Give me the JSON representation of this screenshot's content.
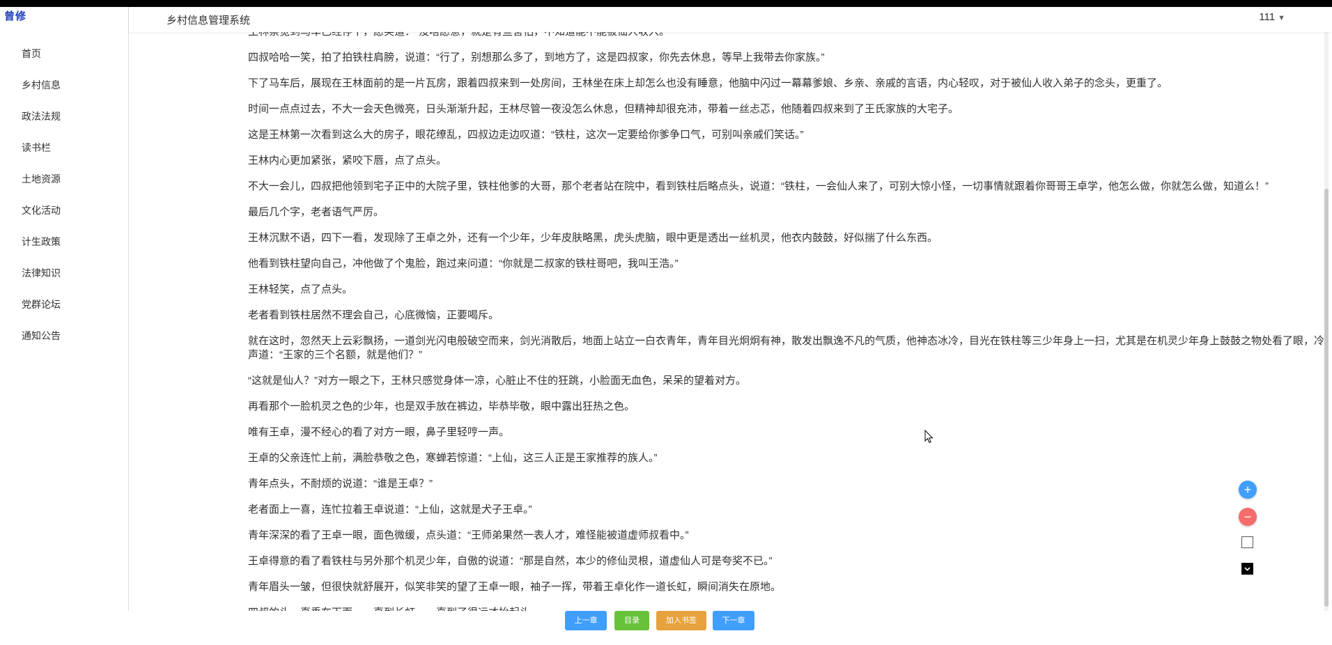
{
  "app": {
    "logo": "曾修",
    "system_title": "乡村信息管理系统",
    "user_name": "111"
  },
  "sidebar": {
    "items": [
      {
        "label": "首页"
      },
      {
        "label": "乡村信息"
      },
      {
        "label": "政法法规"
      },
      {
        "label": "读书栏"
      },
      {
        "label": "土地资源"
      },
      {
        "label": "文化活动"
      },
      {
        "label": "计生政策"
      },
      {
        "label": "法律知识"
      },
      {
        "label": "党群论坛"
      },
      {
        "label": "通知公告"
      }
    ]
  },
  "article": {
    "paragraphs": [
      "王林察觉到马车已经停下，愿笑道：“没啥愿意，就是有些害怕，不知道能不能被仙人收入。”",
      "四叔哈哈一笑，拍了拍铁柱肩膀，说道：“行了，别想那么多了，到地方了，这是四叔家，你先去休息，等早上我带去你家族。”",
      "下了马车后，展现在王林面前的是一片瓦房，跟着四叔来到一处房间，王林坐在床上却怎么也没有睡意，他脑中闪过一幕幕爹娘、乡亲、亲戚的言语，内心轻叹，对于被仙人收入弟子的念头，更重了。",
      "时间一点点过去，不大一会天色微亮，日头渐渐升起，王林尽管一夜没怎么休息，但精神却很充沛，带着一丝忐忑，他随着四叔来到了王氏家族的大宅子。",
      "这是王林第一次看到这么大的房子，眼花缭乱，四叔边走边叹道：“铁柱，这次一定要给你爹争口气，可别叫亲戚们笑话。”",
      "王林内心更加紧张，紧咬下唇，点了点头。",
      "不大一会儿，四叔把他领到宅子正中的大院子里，铁柱他爹的大哥，那个老者站在院中，看到铁柱后略点头，说道：“铁柱，一会仙人来了，可别大惊小怪，一切事情就跟着你哥哥王卓学，他怎么做，你就怎么做，知道么！”",
      "最后几个字，老者语气严厉。",
      "王林沉默不语，四下一看，发现除了王卓之外，还有一个少年，少年皮肤略黑，虎头虎脑，眼中更是透出一丝机灵，他衣内鼓鼓，好似揣了什么东西。",
      "他看到铁柱望向自己，冲他做了个鬼脸，跑过来问道：“你就是二叔家的铁柱哥吧，我叫王浩。”",
      "王林轻笑，点了点头。",
      "老者看到铁柱居然不理会自己，心底微恼，正要喝斥。",
      "就在这时，忽然天上云彩飘扬，一道剑光闪电般破空而来，剑光消散后，地面上站立一白衣青年，青年目光炯炯有神，散发出飘逸不凡的气质，他神态冰冷，目光在铁柱等三少年身上一扫，尤其是在机灵少年身上鼓鼓之物处看了眼，冷声道：“王家的三个名额，就是他们？”",
      "“这就是仙人？”对方一眼之下，王林只感觉身体一凉，心脏止不住的狂跳，小脸面无血色，呆呆的望着对方。",
      "再看那个一脸机灵之色的少年，也是双手放在裤边，毕恭毕敬，眼中露出狂热之色。",
      "唯有王卓，漫不经心的看了对方一眼，鼻子里轻哼一声。",
      "王卓的父亲连忙上前，满脸恭敬之色，寒蝉若惊道：“上仙，这三人正是王家推荐的族人。”",
      "青年点头，不耐烦的说道：“谁是王卓？”",
      "老者面上一喜，连忙拉着王卓说道：“上仙，这就是犬子王卓。”",
      "青年深深的看了王卓一眼，面色微缓，点头道：“王师弟果然一表人才，难怪能被道虚师叔看中。”",
      "王卓得意的看了看铁柱与另外那个机灵少年，自傲的说道：“那是自然，本少的修仙灵根，道虚仙人可是夸奖不已。”",
      "青年眉头一皱，但很快就舒展开，似笑非笑的望了王卓一眼，袖子一挥，带着王卓化作一道长虹，瞬间消失在原地。",
      "四叔的头一直垂在下面，一直到长虹，一直到了很远才抬起头。"
    ]
  },
  "reader": {
    "prev_label": "上一章",
    "toc_label": "目录",
    "bookmark_label": "加入书签",
    "next_label": "下一章",
    "zoom_in": "+",
    "zoom_out": "−"
  },
  "colors": {
    "prev": "#409eff",
    "toc": "#67c23a",
    "bookmark": "#e6a23c",
    "next": "#409eff",
    "zoom_in": "#409eff",
    "zoom_out": "#f56c6c"
  }
}
